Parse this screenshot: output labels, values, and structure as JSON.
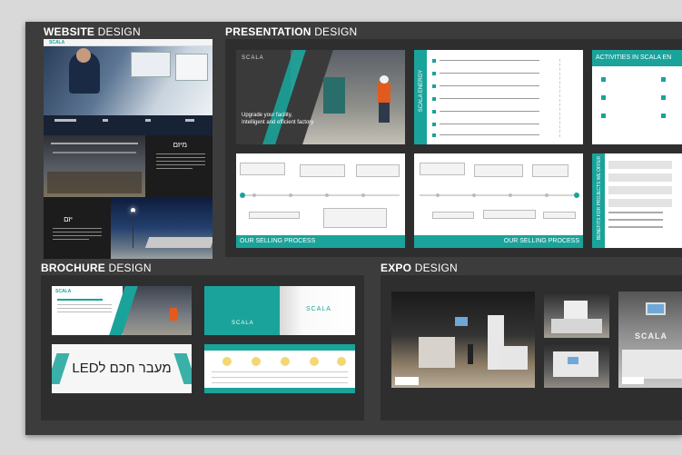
{
  "sections": {
    "website": {
      "bold": "WEBSITE",
      "light": "DESIGN"
    },
    "presentation": {
      "bold": "PRESENTATION",
      "light": "DESIGN"
    },
    "brochure": {
      "bold": "BROCHURE",
      "light": "DESIGN"
    },
    "expo": {
      "bold": "EXPO",
      "light": "DESIGN"
    }
  },
  "website": {
    "logo": "SCALA",
    "panel1_title": "מיזם",
    "panel2_title": "יזם"
  },
  "presentation": {
    "cover_logo": "SCALA",
    "cover_headline_1": "Upgrade your facility,",
    "cover_headline_2": "Intelligent and efficient factory",
    "vertical_label": "SCALA ENERGY",
    "activities_title": "ACTIVITIES IN SCALA EN",
    "selling_1": "OUR SELLING PROCESS",
    "selling_2": "OUR SELLING PROCESS",
    "vertical_label_2": "BENEFITS FOR PROJECTS WE OFFER"
  },
  "brochure": {
    "logo": "SCALA",
    "hebrew_headline": "מעבר חכם לLED"
  },
  "expo": {
    "booth_logo": "SCALA"
  },
  "colors": {
    "accent": "#1aa39a",
    "board": "#3c3c3c",
    "panel": "#2e2e2e"
  }
}
